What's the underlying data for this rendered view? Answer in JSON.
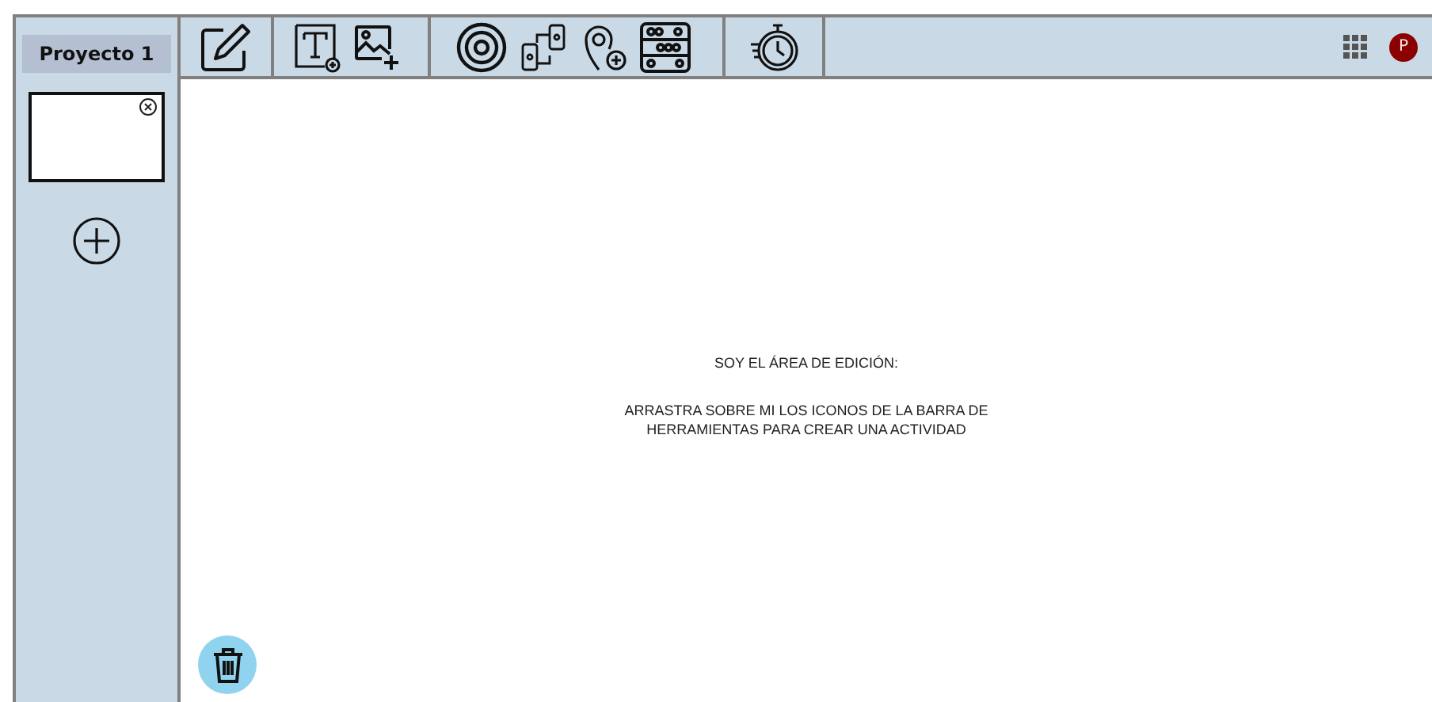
{
  "project": {
    "title": "Proyecto 1"
  },
  "user": {
    "initial": "P"
  },
  "editor": {
    "heading": "SOY EL ÁREA DE EDICIÓN:",
    "hint": "ARRASTRA SOBRE MI LOS ICONOS DE LA BARRA DE HERRAMIENTAS PARA CREAR UNA ACTIVIDAD"
  }
}
